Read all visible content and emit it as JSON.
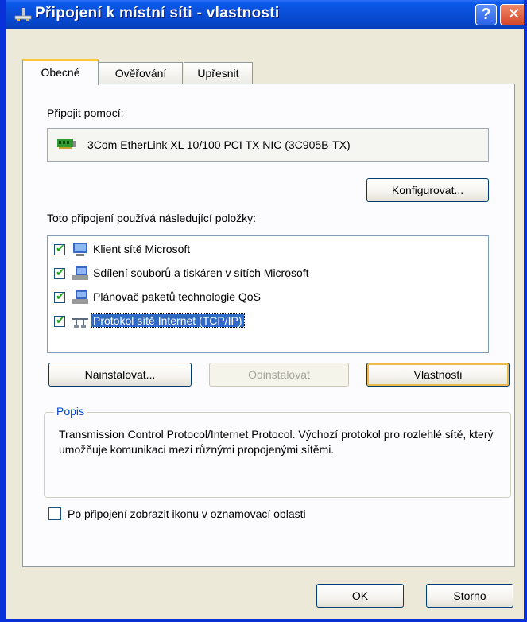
{
  "window": {
    "title": "Připojení k místní síti - vlastnosti"
  },
  "titlebar_buttons": {
    "help": "?",
    "close": "✕"
  },
  "tabs": [
    {
      "label": "Obecné",
      "active": true
    },
    {
      "label": "Ověřování",
      "active": false
    },
    {
      "label": "Upřesnit",
      "active": false
    }
  ],
  "connect_using": {
    "label": "Připojit pomocí:",
    "adapter": "3Com EtherLink XL 10/100 PCI TX NIC (3C905B-TX)",
    "configure_button": "Konfigurovat..."
  },
  "components": {
    "label": "Toto připojení používá následující položky:",
    "items": [
      {
        "label": "Klient sítě Microsoft",
        "checked": true,
        "icon": "computer-icon"
      },
      {
        "label": "Sdílení souborů a tiskáren v sítích Microsoft",
        "checked": true,
        "icon": "computer-icon"
      },
      {
        "label": "Plánovač paketů technologie QoS",
        "checked": true,
        "icon": "computer-icon"
      },
      {
        "label": "Protokol sítě Internet (TCP/IP)",
        "checked": true,
        "selected": true,
        "icon": "network-protocol-icon"
      }
    ]
  },
  "actions": {
    "install": "Nainstalovat...",
    "uninstall": "Odinstalovat",
    "properties": "Vlastnosti"
  },
  "description": {
    "title": "Popis",
    "text": "Transmission Control Protocol/Internet Protocol. Výchozí protokol pro rozlehlé sítě, který umožňuje komunikaci mezi různými propojenými sítěmi."
  },
  "show_icon": {
    "label": "Po připojení zobrazit ikonu v oznamovací oblasti",
    "checked": false
  },
  "dialog_buttons": {
    "ok": "OK",
    "cancel": "Storno"
  },
  "colors": {
    "titlebar": "#0a4fd8",
    "selection": "#316ac5",
    "group_title": "#0046d5",
    "checkmark": "#21a121"
  }
}
